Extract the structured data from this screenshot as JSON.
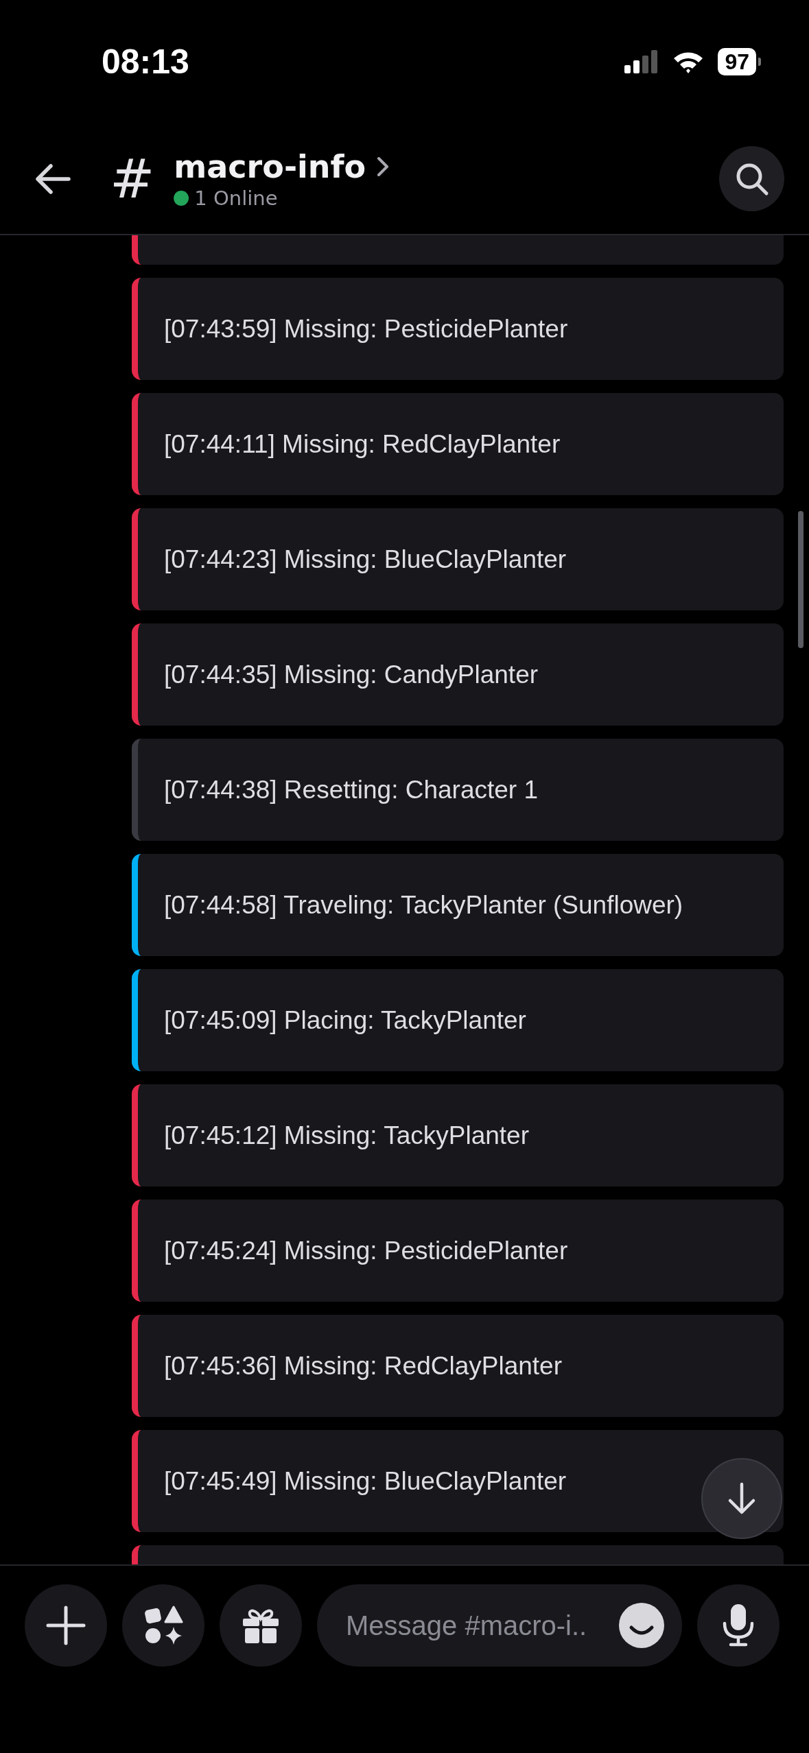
{
  "status_bar": {
    "time": "08:13",
    "battery": "97"
  },
  "header": {
    "channel_icon": "#",
    "title": "macro-info",
    "online": "1 Online"
  },
  "messages": [
    {
      "kind": "partial_top",
      "color": "#e5294a"
    },
    {
      "kind": "embed",
      "color": "#e5294a",
      "text": "[07:43:59] Missing: PesticidePlanter"
    },
    {
      "kind": "embed",
      "color": "#e5294a",
      "text": "[07:44:11] Missing: RedClayPlanter"
    },
    {
      "kind": "embed",
      "color": "#e5294a",
      "text": "[07:44:23] Missing: BlueClayPlanter"
    },
    {
      "kind": "embed",
      "color": "#e5294a",
      "text": "[07:44:35] Missing: CandyPlanter"
    },
    {
      "kind": "embed",
      "color": "#3a3a42",
      "text": "[07:44:38] Resetting: Character 1"
    },
    {
      "kind": "embed",
      "color": "#00b0f4",
      "text": "[07:44:58] Traveling: TackyPlanter (Sunflower)"
    },
    {
      "kind": "embed",
      "color": "#00b0f4",
      "text": "[07:45:09] Placing: TackyPlanter"
    },
    {
      "kind": "embed",
      "color": "#e5294a",
      "text": "[07:45:12] Missing: TackyPlanter"
    },
    {
      "kind": "embed",
      "color": "#e5294a",
      "text": "[07:45:24] Missing: PesticidePlanter"
    },
    {
      "kind": "embed",
      "color": "#e5294a",
      "text": "[07:45:36] Missing: RedClayPlanter"
    },
    {
      "kind": "embed",
      "color": "#e5294a",
      "text": "[07:45:49] Missing: BlueClayPlanter"
    },
    {
      "kind": "partial_bottom",
      "color": "#e5294a"
    }
  ],
  "composer": {
    "placeholder": "Message #macro-i.."
  }
}
